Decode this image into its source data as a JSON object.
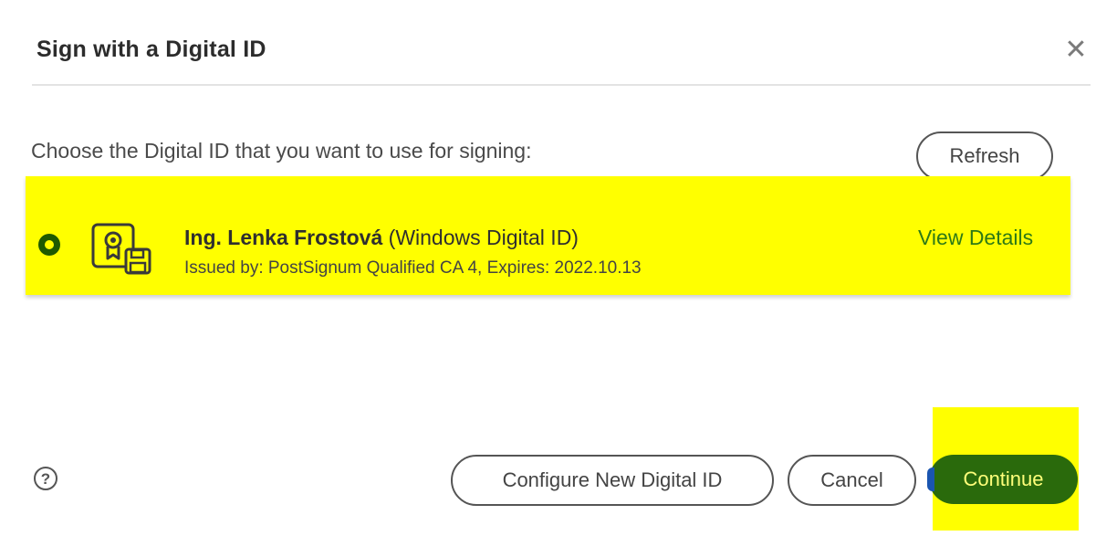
{
  "dialog": {
    "title": "Sign with a Digital ID",
    "close_icon": "close-icon"
  },
  "prompt": "Choose the Digital ID that you want to use for signing:",
  "refresh_label": "Refresh",
  "digital_id": {
    "name": "Ing. Lenka Frostová",
    "type": "(Windows Digital ID)",
    "issued": "Issued by: PostSignum Qualified CA 4, Expires: 2022.10.13",
    "view_details": "View Details",
    "selected": true,
    "icon": "certificate-icon"
  },
  "footer": {
    "help_icon": "help-icon",
    "configure_label": "Configure New Digital ID",
    "cancel_label": "Cancel",
    "continue_label": "Continue"
  },
  "colors": {
    "highlight": "#ffff00",
    "accent_green": "#2a6a0c",
    "link_green": "#2e7a16"
  }
}
